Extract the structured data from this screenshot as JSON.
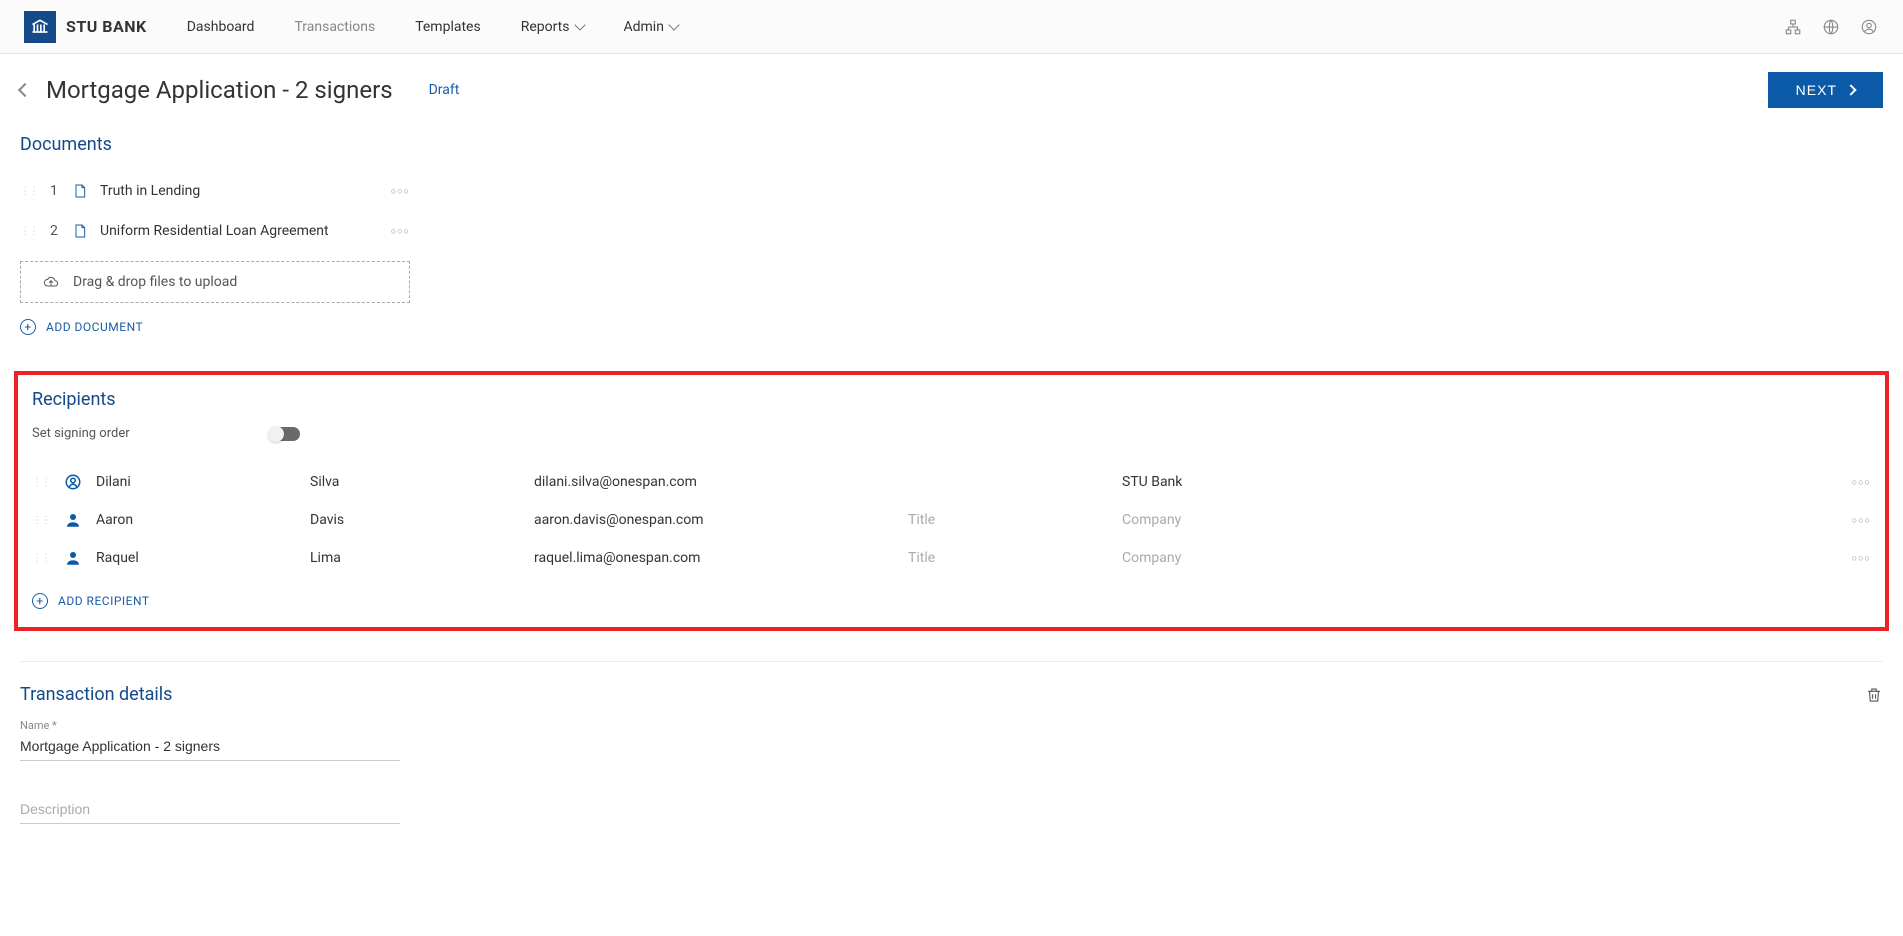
{
  "header": {
    "brand": "STU BANK",
    "nav": [
      "Dashboard",
      "Transactions",
      "Templates",
      "Reports",
      "Admin"
    ]
  },
  "page": {
    "title": "Mortgage Application - 2 signers",
    "status": "Draft",
    "next_label": "NEXT"
  },
  "documents": {
    "heading": "Documents",
    "items": [
      {
        "index": "1",
        "name": "Truth in Lending"
      },
      {
        "index": "2",
        "name": "Uniform Residential Loan Agreement"
      }
    ],
    "dropzone_label": "Drag & drop files to upload",
    "add_label": "ADD DOCUMENT"
  },
  "recipients": {
    "heading": "Recipients",
    "signing_order_label": "Set signing order",
    "title_placeholder": "Title",
    "company_placeholder": "Company",
    "items": [
      {
        "first": "Dilani",
        "last": "Silva",
        "email": "dilani.silva@onespan.com",
        "title": "",
        "company": "STU Bank",
        "owner": true
      },
      {
        "first": "Aaron",
        "last": "Davis",
        "email": "aaron.davis@onespan.com",
        "title": "",
        "company": "",
        "owner": false
      },
      {
        "first": "Raquel",
        "last": "Lima",
        "email": "raquel.lima@onespan.com",
        "title": "",
        "company": "",
        "owner": false
      }
    ],
    "add_label": "ADD RECIPIENT"
  },
  "details": {
    "heading": "Transaction details",
    "name_label": "Name *",
    "name_value": "Mortgage Application - 2 signers",
    "description_placeholder": "Description"
  }
}
